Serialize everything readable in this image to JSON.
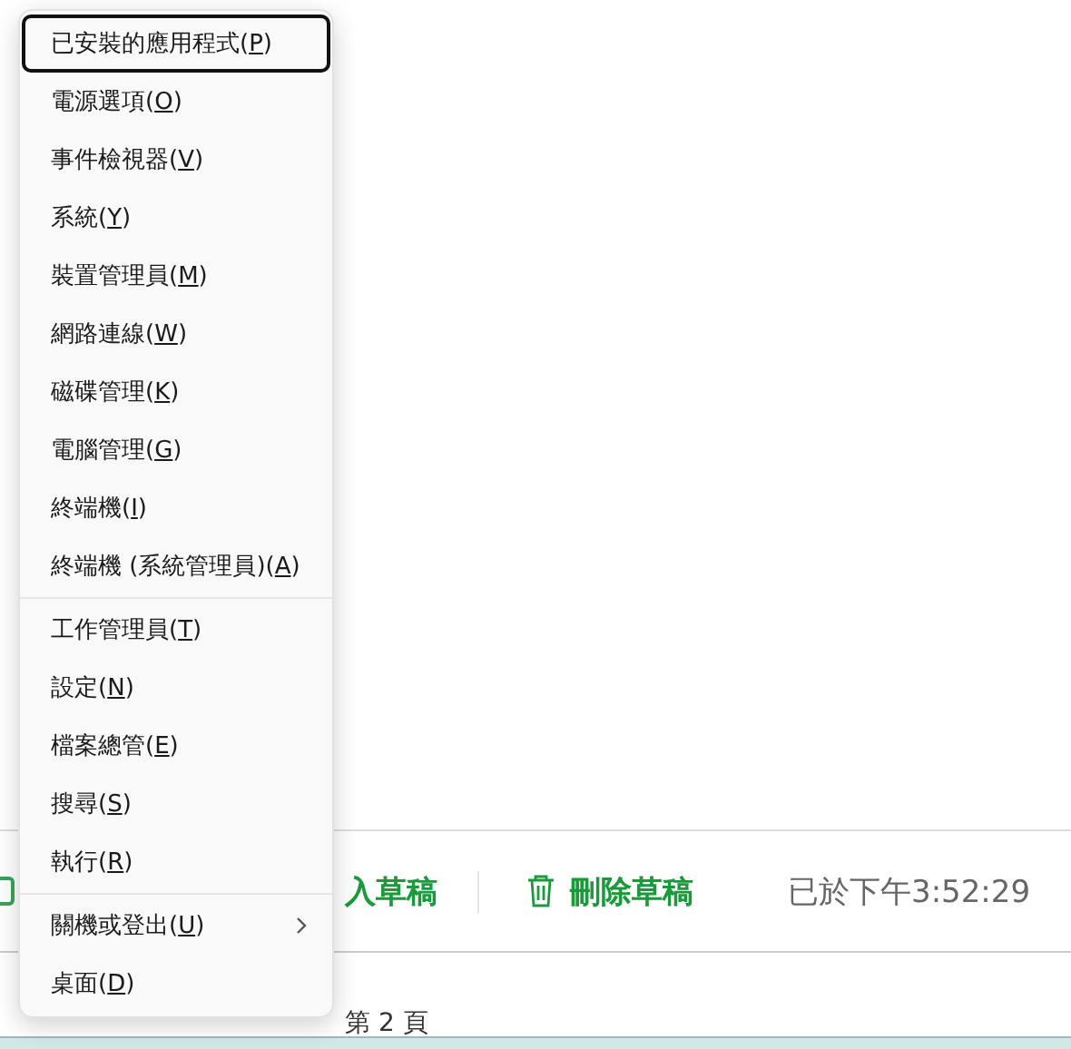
{
  "background": {
    "toolbar": [
      {
        "kind": "text-button",
        "label": "入草稿"
      },
      {
        "kind": "icon-button",
        "label": "刪除草稿"
      }
    ],
    "save_status": "已於下午3:52:29",
    "page_label": "第 2 頁"
  },
  "menu": {
    "groups": [
      [
        {
          "text": "已安裝的應用程式(",
          "accel": "P",
          "close": ")",
          "selected": true,
          "submenu": false
        },
        {
          "text": "電源選項(",
          "accel": "O",
          "close": ")",
          "selected": false,
          "submenu": false
        },
        {
          "text": "事件檢視器(",
          "accel": "V",
          "close": ")",
          "selected": false,
          "submenu": false
        },
        {
          "text": "系統(",
          "accel": "Y",
          "close": ")",
          "selected": false,
          "submenu": false
        },
        {
          "text": "裝置管理員(",
          "accel": "M",
          "close": ")",
          "selected": false,
          "submenu": false
        },
        {
          "text": "網路連線(",
          "accel": "W",
          "close": ")",
          "selected": false,
          "submenu": false
        },
        {
          "text": "磁碟管理(",
          "accel": "K",
          "close": ")",
          "selected": false,
          "submenu": false
        },
        {
          "text": "電腦管理(",
          "accel": "G",
          "close": ")",
          "selected": false,
          "submenu": false
        },
        {
          "text": "終端機(",
          "accel": "I",
          "close": ")",
          "selected": false,
          "submenu": false
        },
        {
          "text": "終端機 (系統管理員)(",
          "accel": "A",
          "close": ")",
          "selected": false,
          "submenu": false
        }
      ],
      [
        {
          "text": "工作管理員(",
          "accel": "T",
          "close": ")",
          "selected": false,
          "submenu": false
        },
        {
          "text": "設定(",
          "accel": "N",
          "close": ")",
          "selected": false,
          "submenu": false
        },
        {
          "text": "檔案總管(",
          "accel": "E",
          "close": ")",
          "selected": false,
          "submenu": false
        },
        {
          "text": "搜尋(",
          "accel": "S",
          "close": ")",
          "selected": false,
          "submenu": false
        },
        {
          "text": "執行(",
          "accel": "R",
          "close": ")",
          "selected": false,
          "submenu": false
        }
      ],
      [
        {
          "text": "關機或登出(",
          "accel": "U",
          "close": ")",
          "selected": false,
          "submenu": true
        },
        {
          "text": "桌面(",
          "accel": "D",
          "close": ")",
          "selected": false,
          "submenu": false
        }
      ]
    ]
  }
}
